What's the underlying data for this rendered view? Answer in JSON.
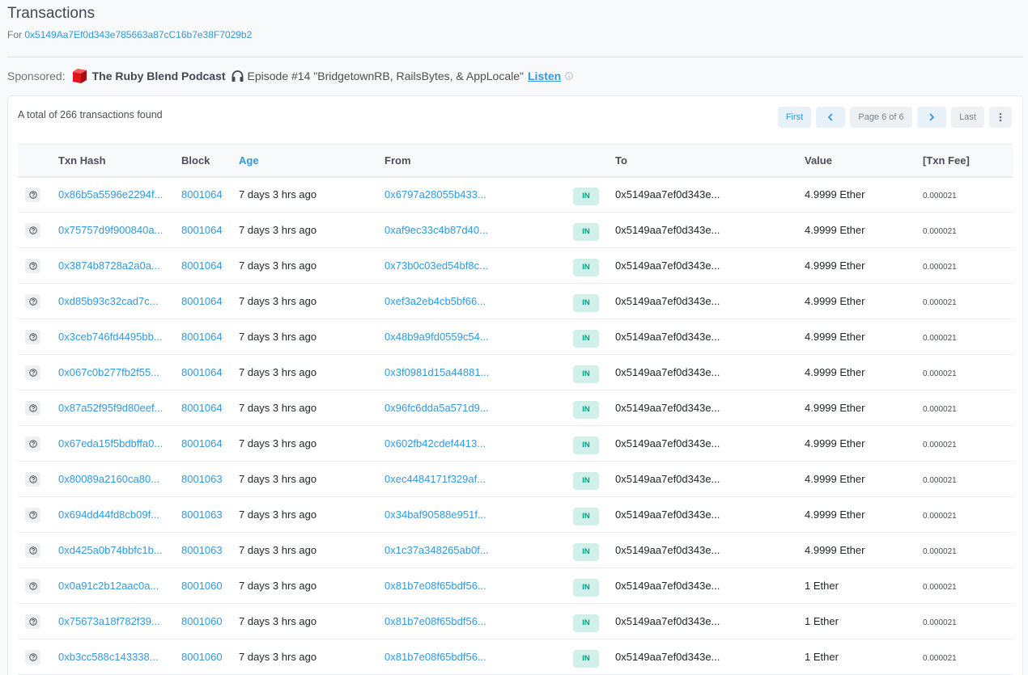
{
  "header": {
    "title": "Transactions",
    "for_prefix": "For",
    "address": "0x5149Aa7Ef0d343e785663a87cC16b7e38F7029b2"
  },
  "sponsor": {
    "label": "Sponsored:",
    "podcast": "The Ruby Blend Podcast",
    "episode": "Episode #14 \"BridgetownRB, RailsBytes, & AppLocale\"",
    "listen": "Listen",
    "logo_color": "#e0161b"
  },
  "summary": {
    "total_text": "A total of 266 transactions found"
  },
  "pager": {
    "first": "First",
    "prev_icon": "chevron-left-icon",
    "page_text": "Page 6 of 6",
    "next_icon": "chevron-right-icon",
    "last": "Last",
    "more_icon": "vertical-dots-icon"
  },
  "table": {
    "headers": {
      "hash": "Txn Hash",
      "block": "Block",
      "age": "Age",
      "from": "From",
      "to": "To",
      "value": "Value",
      "fee": "[Txn Fee]"
    },
    "rows": [
      {
        "hash": "0x86b5a5596e2294f...",
        "block": "8001064",
        "age": "7 days 3 hrs ago",
        "from": "0x6797a28055b433...",
        "dir": "IN",
        "to": "0x5149aa7ef0d343e...",
        "value": "4.9999 Ether",
        "fee": "0.000021"
      },
      {
        "hash": "0x75757d9f900840a...",
        "block": "8001064",
        "age": "7 days 3 hrs ago",
        "from": "0xaf9ec33c4b87d40...",
        "dir": "IN",
        "to": "0x5149aa7ef0d343e...",
        "value": "4.9999 Ether",
        "fee": "0.000021"
      },
      {
        "hash": "0x3874b8728a2a0a...",
        "block": "8001064",
        "age": "7 days 3 hrs ago",
        "from": "0x73b0c03ed54bf8c...",
        "dir": "IN",
        "to": "0x5149aa7ef0d343e...",
        "value": "4.9999 Ether",
        "fee": "0.000021"
      },
      {
        "hash": "0xd85b93c32cad7c...",
        "block": "8001064",
        "age": "7 days 3 hrs ago",
        "from": "0xef3a2eb4cb5bf66...",
        "dir": "IN",
        "to": "0x5149aa7ef0d343e...",
        "value": "4.9999 Ether",
        "fee": "0.000021"
      },
      {
        "hash": "0x3ceb746fd4495bb...",
        "block": "8001064",
        "age": "7 days 3 hrs ago",
        "from": "0x48b9a9fd0559c54...",
        "dir": "IN",
        "to": "0x5149aa7ef0d343e...",
        "value": "4.9999 Ether",
        "fee": "0.000021"
      },
      {
        "hash": "0x067c0b277fb2f55...",
        "block": "8001064",
        "age": "7 days 3 hrs ago",
        "from": "0x3f0981d15a44881...",
        "dir": "IN",
        "to": "0x5149aa7ef0d343e...",
        "value": "4.9999 Ether",
        "fee": "0.000021"
      },
      {
        "hash": "0x87a52f95f9d80eef...",
        "block": "8001064",
        "age": "7 days 3 hrs ago",
        "from": "0x96fc6dda5a571d9...",
        "dir": "IN",
        "to": "0x5149aa7ef0d343e...",
        "value": "4.9999 Ether",
        "fee": "0.000021"
      },
      {
        "hash": "0x67eda15f5bdbffa0...",
        "block": "8001064",
        "age": "7 days 3 hrs ago",
        "from": "0x602fb42cdef4413...",
        "dir": "IN",
        "to": "0x5149aa7ef0d343e...",
        "value": "4.9999 Ether",
        "fee": "0.000021"
      },
      {
        "hash": "0x80089a2160ca80...",
        "block": "8001063",
        "age": "7 days 3 hrs ago",
        "from": "0xec4484171f329af...",
        "dir": "IN",
        "to": "0x5149aa7ef0d343e...",
        "value": "4.9999 Ether",
        "fee": "0.000021"
      },
      {
        "hash": "0x694dd44fd8cb09f...",
        "block": "8001063",
        "age": "7 days 3 hrs ago",
        "from": "0x34baf90588e951f...",
        "dir": "IN",
        "to": "0x5149aa7ef0d343e...",
        "value": "4.9999 Ether",
        "fee": "0.000021"
      },
      {
        "hash": "0xd425a0b74bbfc1b...",
        "block": "8001063",
        "age": "7 days 3 hrs ago",
        "from": "0x1c37a348265ab0f...",
        "dir": "IN",
        "to": "0x5149aa7ef0d343e...",
        "value": "4.9999 Ether",
        "fee": "0.000021"
      },
      {
        "hash": "0x0a91c2b12aac0a...",
        "block": "8001060",
        "age": "7 days 3 hrs ago",
        "from": "0x81b7e08f65bdf56...",
        "dir": "IN",
        "to": "0x5149aa7ef0d343e...",
        "value": "1 Ether",
        "fee": "0.000021"
      },
      {
        "hash": "0x75673a18f782f39...",
        "block": "8001060",
        "age": "7 days 3 hrs ago",
        "from": "0x81b7e08f65bdf56...",
        "dir": "IN",
        "to": "0x5149aa7ef0d343e...",
        "value": "1 Ether",
        "fee": "0.000021"
      },
      {
        "hash": "0xb3cc588c143338...",
        "block": "8001060",
        "age": "7 days 3 hrs ago",
        "from": "0x81b7e08f65bdf56...",
        "dir": "IN",
        "to": "0x5149aa7ef0d343e...",
        "value": "1 Ether",
        "fee": "0.000021"
      }
    ]
  }
}
